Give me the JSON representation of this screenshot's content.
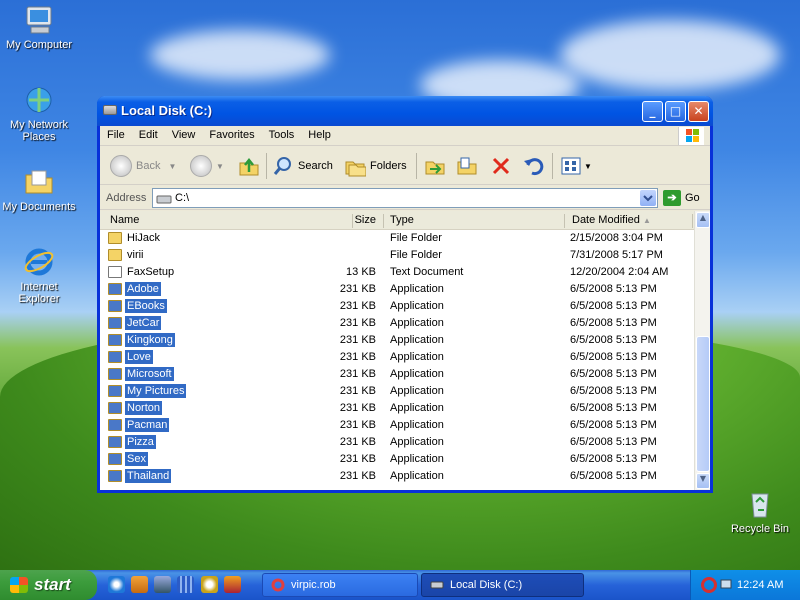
{
  "desktop": {
    "icons": [
      {
        "label": "My Computer"
      },
      {
        "label": "My Network Places"
      },
      {
        "label": "My Documents"
      },
      {
        "label": "Internet Explorer"
      },
      {
        "label": "Recycle Bin"
      }
    ]
  },
  "window": {
    "title": "Local Disk (C:)",
    "menu": [
      "File",
      "Edit",
      "View",
      "Favorites",
      "Tools",
      "Help"
    ],
    "toolbar": {
      "back": "Back",
      "search": "Search",
      "folders": "Folders"
    },
    "address": {
      "label": "Address",
      "value": "C:\\",
      "go": "Go"
    },
    "columns": {
      "name": "Name",
      "size": "Size",
      "type": "Type",
      "date": "Date Modified"
    },
    "files": [
      {
        "name": "HiJack",
        "size": "",
        "type": "File Folder",
        "date": "2/15/2008 3:04 PM",
        "icon": "folder",
        "selected": false
      },
      {
        "name": "virii",
        "size": "",
        "type": "File Folder",
        "date": "7/31/2008 5:17 PM",
        "icon": "folder",
        "selected": false
      },
      {
        "name": "FaxSetup",
        "size": "13 KB",
        "type": "Text Document",
        "date": "12/20/2004 2:04 AM",
        "icon": "text",
        "selected": false
      },
      {
        "name": "Adobe",
        "size": "231 KB",
        "type": "Application",
        "date": "6/5/2008 5:13 PM",
        "icon": "folder",
        "selected": true
      },
      {
        "name": "EBooks",
        "size": "231 KB",
        "type": "Application",
        "date": "6/5/2008 5:13 PM",
        "icon": "folder",
        "selected": true
      },
      {
        "name": "JetCar",
        "size": "231 KB",
        "type": "Application",
        "date": "6/5/2008 5:13 PM",
        "icon": "folder",
        "selected": true
      },
      {
        "name": "Kingkong",
        "size": "231 KB",
        "type": "Application",
        "date": "6/5/2008 5:13 PM",
        "icon": "folder",
        "selected": true
      },
      {
        "name": "Love",
        "size": "231 KB",
        "type": "Application",
        "date": "6/5/2008 5:13 PM",
        "icon": "folder",
        "selected": true
      },
      {
        "name": "Microsoft",
        "size": "231 KB",
        "type": "Application",
        "date": "6/5/2008 5:13 PM",
        "icon": "folder",
        "selected": true
      },
      {
        "name": "My Pictures",
        "size": "231 KB",
        "type": "Application",
        "date": "6/5/2008 5:13 PM",
        "icon": "folder",
        "selected": true
      },
      {
        "name": "Norton",
        "size": "231 KB",
        "type": "Application",
        "date": "6/5/2008 5:13 PM",
        "icon": "folder",
        "selected": true
      },
      {
        "name": "Pacman",
        "size": "231 KB",
        "type": "Application",
        "date": "6/5/2008 5:13 PM",
        "icon": "folder",
        "selected": true
      },
      {
        "name": "Pizza",
        "size": "231 KB",
        "type": "Application",
        "date": "6/5/2008 5:13 PM",
        "icon": "folder",
        "selected": true
      },
      {
        "name": "Sex",
        "size": "231 KB",
        "type": "Application",
        "date": "6/5/2008 5:13 PM",
        "icon": "folder",
        "selected": true
      },
      {
        "name": "Thailand",
        "size": "231 KB",
        "type": "Application",
        "date": "6/5/2008 5:13 PM",
        "icon": "folder",
        "selected": true
      }
    ]
  },
  "taskbar": {
    "start": "start",
    "tasks": [
      {
        "label": "virpic.rob",
        "active": false
      },
      {
        "label": "Local Disk (C:)",
        "active": true
      }
    ],
    "clock": "12:24 AM"
  },
  "colors": {
    "selection": "#316ac5",
    "titlebar": "#0054e3",
    "taskbar": "#245edb",
    "start": "#3c9c3c"
  }
}
